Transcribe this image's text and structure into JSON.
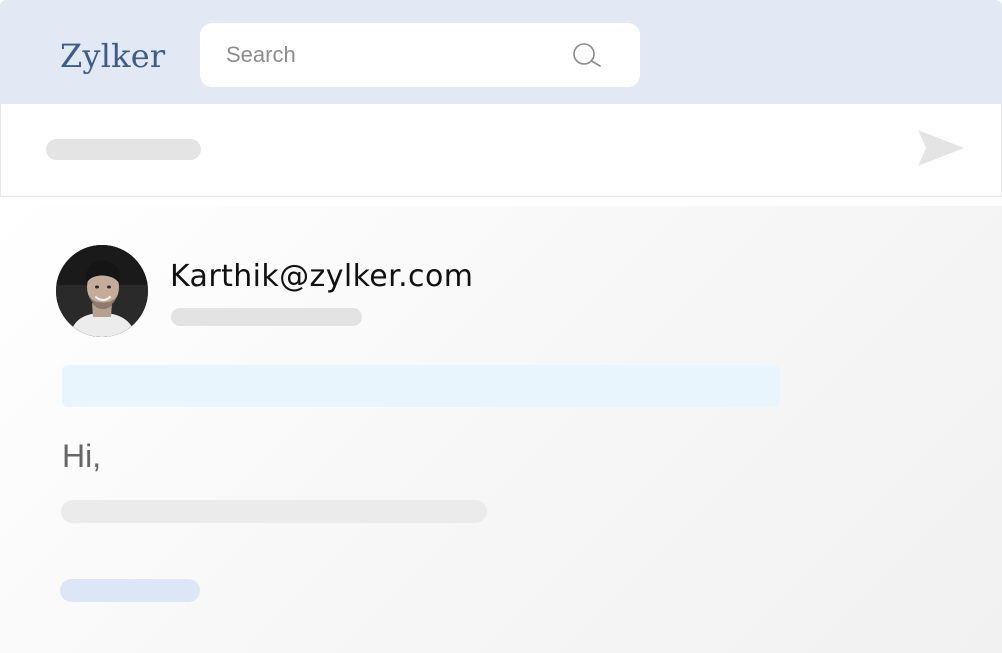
{
  "header": {
    "logo_text": "Zylker",
    "search": {
      "placeholder": "Search",
      "value": "",
      "icon": "search-icon"
    }
  },
  "compose": {
    "send_icon": "send-icon"
  },
  "message": {
    "sender_email": "Karthik@zylker.com",
    "greeting": "Hi,"
  },
  "colors": {
    "header_bg": "#e2e8f4",
    "logo": "#3e5c86",
    "highlight_bar": "#e9f5fd",
    "signature_skeleton": "#dde6f7",
    "skeleton_gray": "#e4e4e4"
  }
}
